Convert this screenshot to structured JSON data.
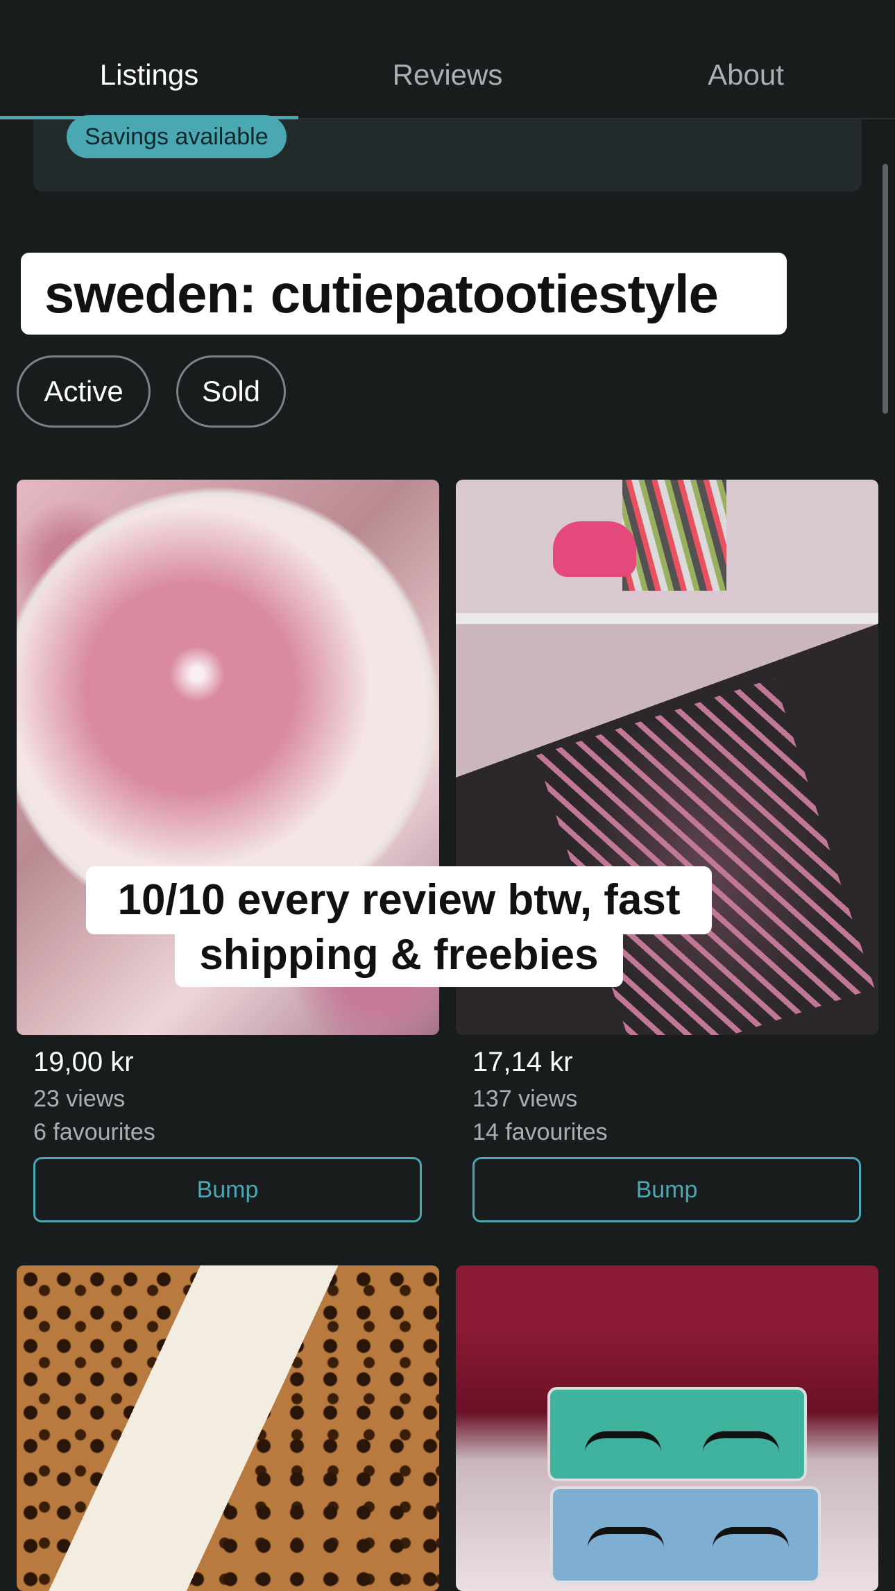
{
  "tabs": [
    {
      "label": "Listings",
      "active": true
    },
    {
      "label": "Reviews",
      "active": false
    },
    {
      "label": "About",
      "active": false
    }
  ],
  "savings_badge": "Savings available",
  "overlay_title": "sweden: cutiepatootiestyle",
  "filters": [
    "Active",
    "Sold"
  ],
  "caption": {
    "line1": "10/10 every review btw, fast",
    "line2": "shipping & freebies"
  },
  "listings": [
    {
      "price": "19,00 kr",
      "views": "23 views",
      "favourites": "6 favourites",
      "bump_label": "Bump"
    },
    {
      "price": "17,14 kr",
      "views": "137 views",
      "favourites": "14 favourites",
      "bump_label": "Bump"
    }
  ],
  "colors": {
    "background": "#181c1d",
    "accent": "#4aa8b3",
    "muted_text": "#a8b0b2"
  }
}
